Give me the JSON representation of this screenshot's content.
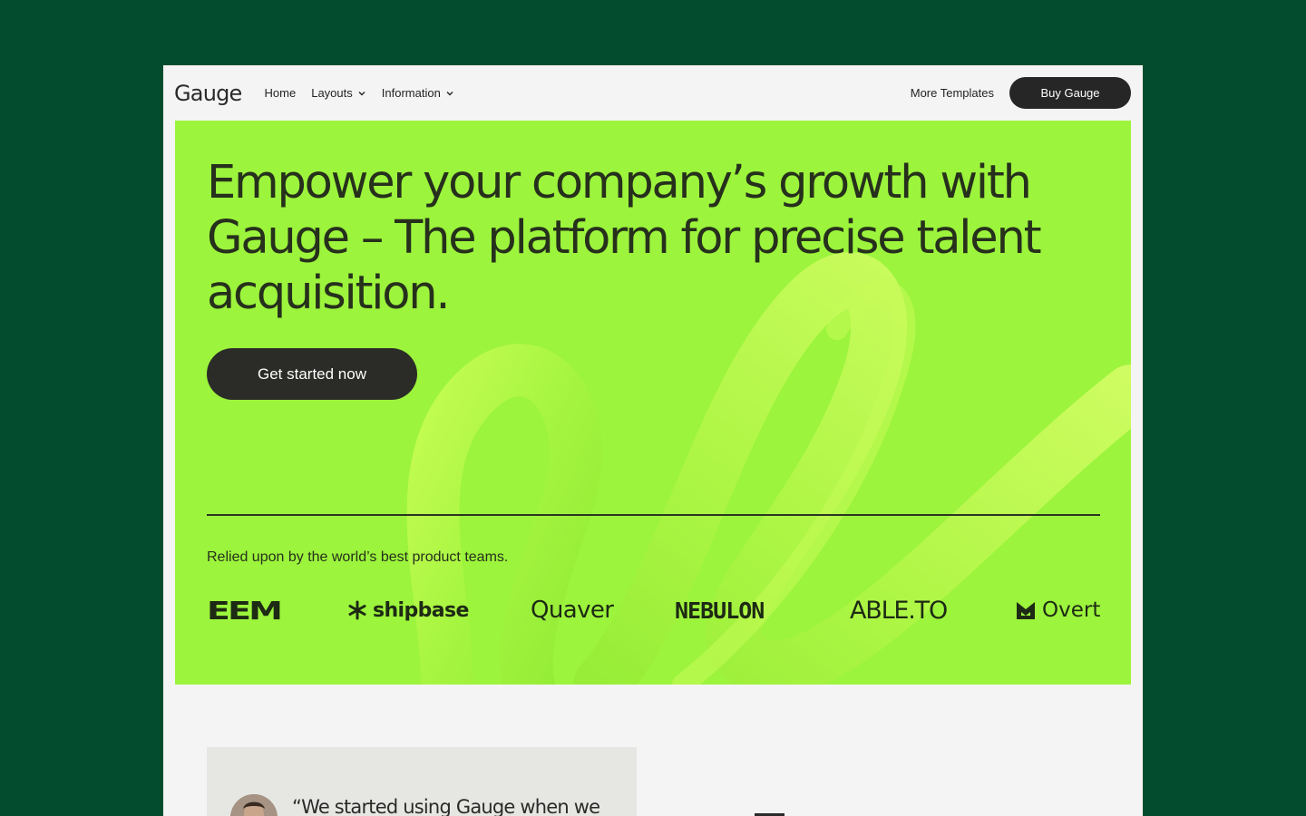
{
  "nav": {
    "logo": "Gauge",
    "links": [
      {
        "label": "Home",
        "has_dropdown": false
      },
      {
        "label": "Layouts",
        "has_dropdown": true
      },
      {
        "label": "Information",
        "has_dropdown": true
      }
    ],
    "more_templates": "More Templates",
    "buy_button": "Buy Gauge"
  },
  "hero": {
    "title": "Empower your company’s growth with Gauge – The platform for precise talent acquisition.",
    "cta": "Get started now",
    "relied_text": "Relied upon by the world’s best product teams.",
    "brands": [
      "EEM",
      "shipbase",
      "Quaver",
      "NEBULON",
      "ABLE.TO",
      "Overt"
    ],
    "background_color": "#9cf43c"
  },
  "testimonial": {
    "quote": "“We started using Gauge when we"
  },
  "colors": {
    "page_background": "#034d2e",
    "frame_background": "#f4f4f4",
    "accent": "#9cf43c",
    "dark": "#262626"
  }
}
